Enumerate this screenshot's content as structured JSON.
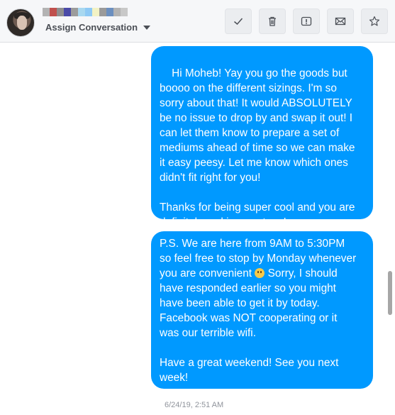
{
  "header": {
    "assign_label": "Assign Conversation",
    "redacted_colors": [
      "#b3b3b3",
      "#c0504d",
      "#8f8f8f",
      "#4a4aa8",
      "#9c9c9c",
      "#a8d8f0",
      "#8ec9f5",
      "#f2f2c4",
      "#9a9a9a",
      "#6b8fbf",
      "#b3b3b3",
      "#c8c8c8"
    ],
    "buttons": [
      {
        "name": "check-button",
        "icon": "check-icon"
      },
      {
        "name": "delete-button",
        "icon": "trash-icon"
      },
      {
        "name": "mark-spam-button",
        "icon": "alert-icon"
      },
      {
        "name": "mark-unread-button",
        "icon": "envelope-icon"
      },
      {
        "name": "star-button",
        "icon": "star-icon"
      }
    ]
  },
  "messages": [
    {
      "text": "Hi Moheb! Yay you go the goods but\nboooo on the different sizings. I'm so\nsorry about that! It would ABSOLUTELY\nbe no issue to drop by and swap it out! I\ncan let them know to prepare a set of\nmediums ahead of time so we can make\nit easy peesy. Let me know which ones\ndidn't fit right for you!\n\nThanks for being super cool and you are\ndefinitely rocking our tees!"
    },
    {
      "text_before_emoji": "P.S. We are here from 9AM to 5:30PM\nso feel free to stop by Monday whenever\nyou are convenient ",
      "emoji": "smile-emoji",
      "text_after_emoji": " Sorry, I should\nhave responded earlier so you might\nhave been able to get it by today.\nFacebook was NOT cooperating or it\nwas our terrible wifi.\n\nHave a great weekend! See you next\nweek!"
    }
  ],
  "timestamp": "6/24/19, 2:51 AM",
  "colors": {
    "bubble": "#0099ff",
    "header_bg": "#f6f7f9"
  }
}
